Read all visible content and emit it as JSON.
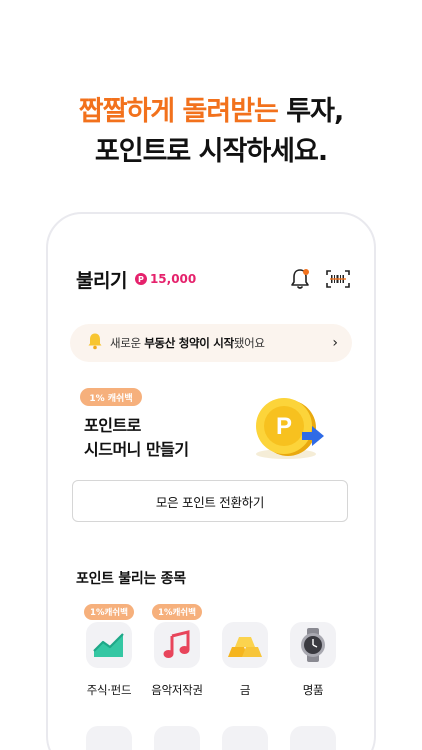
{
  "headline": {
    "line1_accent": "짭짤하게 돌려받는",
    "line1_rest": " 투자,",
    "line2": "포인트로 시작하세요."
  },
  "appbar": {
    "title": "불리기",
    "point_symbol": "P",
    "point_value": "15,000",
    "icons": [
      "bell-icon",
      "barcode-scan-icon"
    ]
  },
  "notice": {
    "icon": "bell-icon",
    "prefix": "새로운 ",
    "bold1": "부동산 청약이 시작",
    "suffix": "됐어요",
    "chevron": "›"
  },
  "promo": {
    "badge": "1% 캐쉬백",
    "title_line1": "포인트로",
    "title_line2": "시드머니 만들기",
    "coin_letter": "P"
  },
  "convert_button": "모은 포인트 전환하기",
  "section": {
    "title": "포인트 불리는 종목",
    "items": [
      {
        "label": "주식·펀드",
        "badge": "1%캐쉬백",
        "icon": "stock-chart-icon"
      },
      {
        "label": "음악저작권",
        "badge": "1%캐쉬백",
        "icon": "music-note-icon"
      },
      {
        "label": "금",
        "badge": "",
        "icon": "gold-bar-icon"
      },
      {
        "label": "명품",
        "badge": "",
        "icon": "watch-icon"
      }
    ]
  },
  "colors": {
    "accent_orange": "#f2711c",
    "point_pink": "#e5226c",
    "cashback_pill": "#f6b07c",
    "notice_bg": "#fbf4ee"
  }
}
